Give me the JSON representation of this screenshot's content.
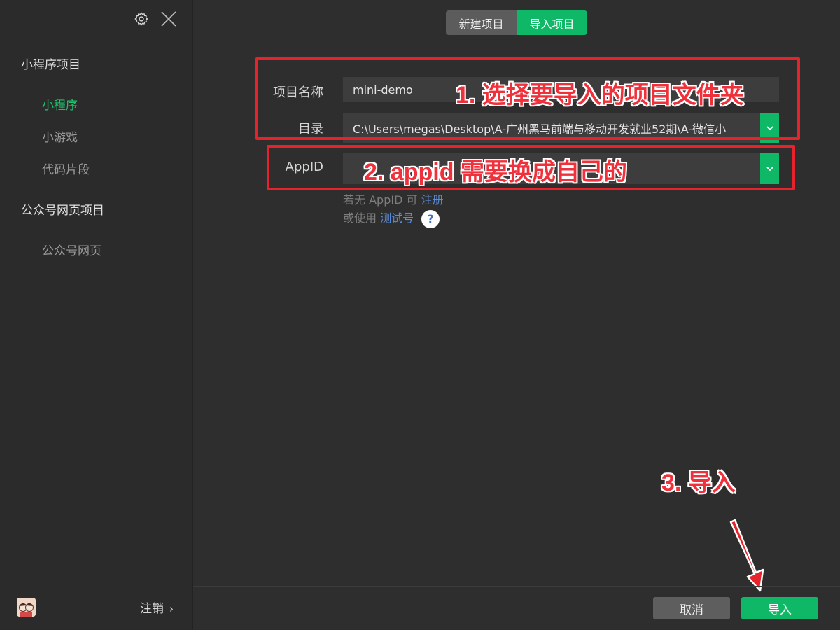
{
  "sidebar": {
    "sections": [
      {
        "title": "小程序项目",
        "items": [
          "小程序",
          "小游戏",
          "代码片段"
        ]
      },
      {
        "title": "公众号网页项目",
        "items": [
          "公众号网页"
        ]
      }
    ],
    "active_item": "小程序",
    "footer": {
      "logout_label": "注销",
      "chevron": "›"
    }
  },
  "tabs": [
    {
      "label": "新建项目",
      "active": false
    },
    {
      "label": "导入项目",
      "active": true
    }
  ],
  "form": {
    "project_name_label": "项目名称",
    "project_name_value": "mini-demo",
    "directory_label": "目录",
    "directory_value": "C:\\Users\\megas\\Desktop\\A-广州黑马前端与移动开发就业52期\\A-微信小",
    "appid_label": "AppID",
    "appid_value": "",
    "hint_line1_prefix": "若无 AppID 可",
    "hint_line1_link": "注册",
    "hint_line2_prefix": "或使用",
    "hint_line2_link": "测试号",
    "help_glyph": "?"
  },
  "annotations": {
    "step1": "1. 选择要导入的项目文件夹",
    "step2": "2. appid 需要换成自己的",
    "step3": "3. 导入"
  },
  "buttons": {
    "cancel": "取消",
    "import": "导入"
  },
  "colors": {
    "accent_green": "#0fb866",
    "active_nav_green": "#1fc26b",
    "annotation_red": "#e8222b",
    "link_blue": "#5b8bd6"
  }
}
